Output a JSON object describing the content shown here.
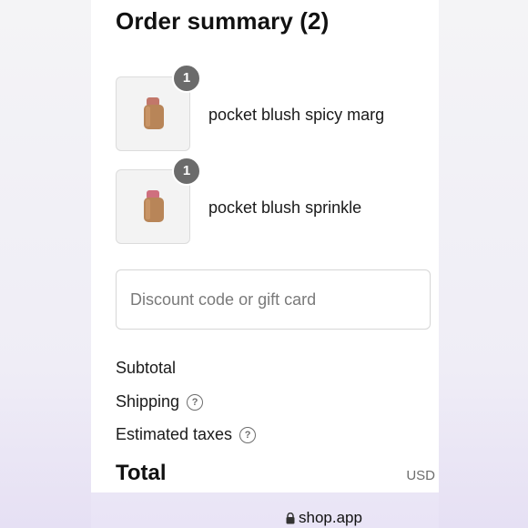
{
  "order_summary": {
    "title": "Order summary (2)",
    "items": [
      {
        "name": "pocket blush spicy marg",
        "quantity": "1",
        "blush_color": "#c2776a"
      },
      {
        "name": "pocket blush sprinkle",
        "quantity": "1",
        "blush_color": "#cf6f7e"
      }
    ]
  },
  "discount": {
    "placeholder": "Discount code or gift card"
  },
  "summary": {
    "subtotal_label": "Subtotal",
    "shipping_label": "Shipping",
    "taxes_label": "Estimated taxes",
    "help_icon": "?",
    "total_label": "Total",
    "currency": "USD"
  },
  "browser": {
    "url": "shop.app",
    "lock_icon": "lock-icon"
  },
  "colors": {
    "badge": "#6b6b6b",
    "panel": "#ffffff",
    "border": "#d6d6d6"
  }
}
